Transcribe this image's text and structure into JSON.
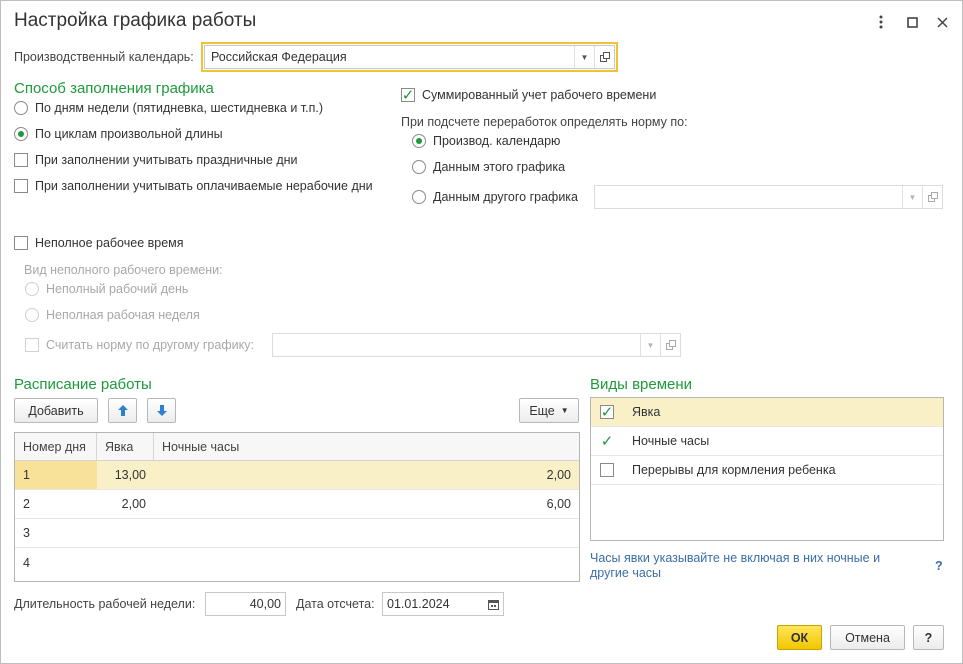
{
  "window": {
    "title": "Настройка графика работы",
    "controls": [
      "more-icon",
      "maximize-icon",
      "close-icon"
    ]
  },
  "calendar": {
    "label": "Производственный календарь:",
    "value": "Российская Федерация"
  },
  "fill_method": {
    "title": "Способ заполнения графика",
    "options": [
      {
        "label": "По дням недели (пятидневка, шестидневка и т.п.)",
        "selected": false
      },
      {
        "label": "По циклам произвольной длины",
        "selected": true
      }
    ],
    "checks": [
      {
        "label": "При заполнении учитывать праздничные дни",
        "checked": false
      },
      {
        "label": "При заполнении учитывать оплачиваемые нерабочие дни",
        "checked": false
      }
    ]
  },
  "summary": {
    "check_label": "Суммированный учет рабочего времени",
    "checked": true,
    "norm_label": "При подсчете переработок определять норму по:",
    "options": [
      {
        "label": "Производ. календарю",
        "selected": true
      },
      {
        "label": "Данным этого графика",
        "selected": false
      },
      {
        "label": "Данным другого графика",
        "selected": false
      }
    ],
    "other_schedule_value": ""
  },
  "part_time": {
    "check_label": "Неполное рабочее время",
    "checked": false,
    "kind_label": "Вид неполного рабочего времени:",
    "options": [
      {
        "label": "Неполный рабочий день"
      },
      {
        "label": "Неполная рабочая неделя"
      }
    ],
    "norm_check_label": "Считать норму по другому графику:",
    "norm_schedule_value": ""
  },
  "schedule": {
    "title": "Расписание работы",
    "add_label": "Добавить",
    "more_label": "Еще",
    "columns": [
      "Номер дня",
      "Явка",
      "Ночные часы"
    ],
    "rows": [
      {
        "day": "1",
        "attendance": "13,00",
        "night": "2,00",
        "selected": true
      },
      {
        "day": "2",
        "attendance": "2,00",
        "night": "6,00",
        "selected": false
      },
      {
        "day": "3",
        "attendance": "",
        "night": "",
        "selected": false
      },
      {
        "day": "4",
        "attendance": "",
        "night": "",
        "selected": false
      }
    ]
  },
  "time_types": {
    "title": "Виды времени",
    "items": [
      {
        "label": "Явка",
        "checked": true,
        "selected": true
      },
      {
        "label": "Ночные часы",
        "checked": true,
        "selected": false
      },
      {
        "label": "Перерывы для кормления ребенка",
        "checked": false,
        "selected": false
      }
    ],
    "hint": "Часы явки указывайте не включая в них ночные и другие часы",
    "help": "?"
  },
  "footer": {
    "week_label": "Длительность рабочей недели:",
    "week_value": "40,00",
    "date_label": "Дата отсчета:",
    "date_value": "01.01.2024",
    "ok_label": "ОК",
    "cancel_label": "Отмена",
    "help_label": "?"
  },
  "colors": {
    "accent_green": "#1e9a3c",
    "focus_yellow": "#f1c232",
    "selection": "#faf0c8",
    "link_blue": "#3b6ea8"
  }
}
